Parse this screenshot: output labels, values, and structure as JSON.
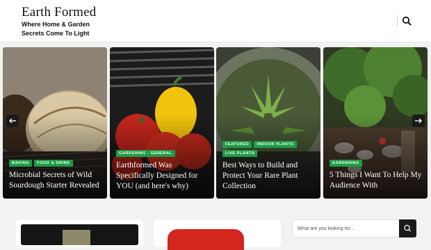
{
  "site": {
    "title": "Earth Formed",
    "tagline": "Where Home & Garden Secrets Come To Light"
  },
  "header": {
    "search_icon": "search-icon"
  },
  "slider": {
    "prev_icon": "arrow-left-icon",
    "next_icon": "arrow-right-icon",
    "cards": [
      {
        "tags": [
          "Baking",
          "Food & Drink"
        ],
        "title": "Microbial Secrets of Wild Sourdough Starter Revealed"
      },
      {
        "tags": [
          "Gardening - General"
        ],
        "title": "Earthformed Was Specifically Designed for YOU (and here's why)"
      },
      {
        "tags": [
          "Featured",
          "Indoor Plants",
          "Live Plants"
        ],
        "title": "Best Ways to Build and Protect Your Rare Plant Collection"
      },
      {
        "tags": [
          "Gardening"
        ],
        "title": "5 Things I Want To Help My Audience With"
      }
    ]
  },
  "sidebar_search": {
    "placeholder": "What are you looking for..."
  },
  "colors": {
    "tag_green": "#1e9c45",
    "dark": "#1b1b1b"
  }
}
